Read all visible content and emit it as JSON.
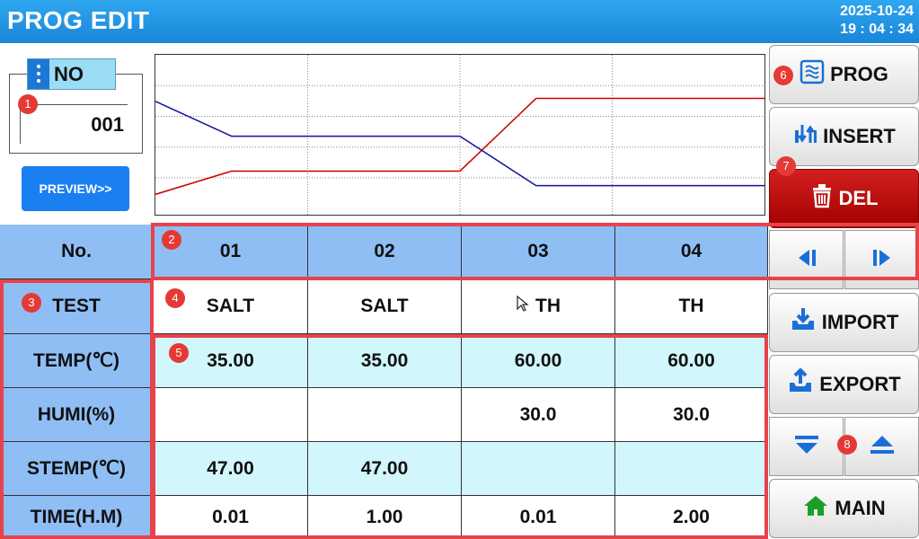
{
  "header": {
    "title": "PROG EDIT",
    "date": "2025-10-24",
    "time": "19 : 04 : 34"
  },
  "program": {
    "no_label": "NO",
    "no_value": "001",
    "preview_label": "PREVIEW>>"
  },
  "chart_data": {
    "type": "line",
    "x": [
      "01",
      "02",
      "03",
      "04"
    ],
    "series": [
      {
        "color": "#cc0000",
        "values": [
          35.0,
          35.0,
          60.0,
          60.0
        ]
      },
      {
        "color": "#1010a0",
        "values": [
          47.0,
          47.0,
          30.0,
          30.0
        ]
      }
    ],
    "grid": true
  },
  "table": {
    "corner_label": "No.",
    "columns": [
      "01",
      "02",
      "03",
      "04"
    ],
    "rows": [
      {
        "label": "TEST",
        "values": [
          "SALT",
          "SALT",
          "TH",
          "TH"
        ]
      },
      {
        "label": "TEMP(℃)",
        "values": [
          "35.00",
          "35.00",
          "60.00",
          "60.00"
        ]
      },
      {
        "label": "HUMI(%)",
        "values": [
          "",
          "",
          "30.0",
          "30.0"
        ]
      },
      {
        "label": "STEMP(℃)",
        "values": [
          "47.00",
          "47.00",
          "",
          ""
        ]
      },
      {
        "label": "TIME(H.M)",
        "values": [
          "0.01",
          "1.00",
          "0.01",
          "2.00"
        ]
      }
    ]
  },
  "sidebar": {
    "prog": "PROG",
    "insert": "INSERT",
    "del": "DEL",
    "import": "IMPORT",
    "export": "EXPORT",
    "main": "MAIN"
  },
  "annotations": [
    "1",
    "2",
    "3",
    "4",
    "5",
    "6",
    "7",
    "8"
  ],
  "colors": {
    "header": "#1a86d8",
    "table_header": "#8fbef5",
    "cyan_row": "#d1f6fb",
    "delete": "#c00000",
    "highlight": "#e8424a"
  }
}
